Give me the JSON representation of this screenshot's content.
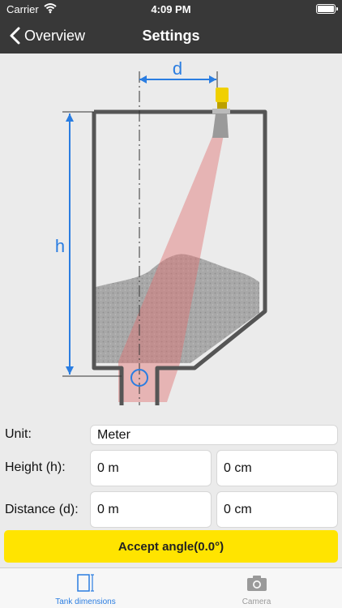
{
  "status_bar": {
    "carrier": "Carrier",
    "time": "4:09 PM",
    "battery_fill": 1.0
  },
  "nav": {
    "back_label": "Overview",
    "title": "Settings"
  },
  "diagram": {
    "h_label": "h",
    "d_label": "d"
  },
  "form": {
    "unit_label": "Unit:",
    "unit_value": "Meter",
    "height_label": "Height (h):",
    "height_m": "0 m",
    "height_cm": "0 cm",
    "distance_label": "Distance (d):",
    "distance_m": "0 m",
    "distance_cm": "0 cm"
  },
  "accept_button": {
    "label": "Accept angle(0.0°)"
  },
  "tabs": [
    {
      "label": "Tank dimensions",
      "icon": "tank-dimensions-icon",
      "selected": true
    },
    {
      "label": "Camera",
      "icon": "camera-icon",
      "selected": false
    }
  ],
  "colors": {
    "bar": "#383838",
    "accent": "#2a7de1",
    "accept": "#ffe400",
    "tab_inactive": "#9a9a9a",
    "beam": "#e07070",
    "sensor": "#f0d000"
  }
}
